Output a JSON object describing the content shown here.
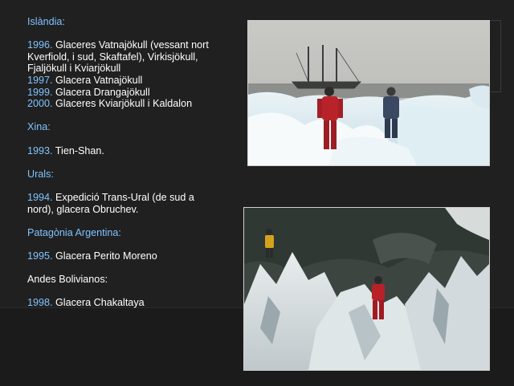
{
  "sections": {
    "islandia": {
      "heading": "Islàndia:",
      "entries": [
        {
          "year": "1996.",
          "text": "Glaceres Vatnajökull (vessant nort Kverfiold, i sud, Skaftafel), Virkisjökull, Fjaljökull i Kviarjökull"
        },
        {
          "year": "1997.",
          "text": "Glacera Vatnajökull"
        },
        {
          "year": "1999.",
          "text": "Glacera Drangajökull"
        },
        {
          "year": "2000.",
          "text": "Glaceres Kviarjökull i Kaldalon"
        }
      ]
    },
    "xina": {
      "heading": "Xina:",
      "entries": [
        {
          "year": "1993.",
          "text": "Tien-Shan."
        }
      ]
    },
    "urals": {
      "heading": "Urals:",
      "entries": [
        {
          "year": "1994.",
          "text": "Expedició Trans-Ural (de sud a nord), glacera Obruchev."
        }
      ]
    },
    "patagonia": {
      "heading": "Patagònia Argentina:",
      "entries": [
        {
          "year": "1995.",
          "text": "Glacera Perito Moreno"
        }
      ]
    },
    "andes": {
      "heading": "Andes Bolivianos:",
      "entries": [
        {
          "year": "1998.",
          "text": "Glacera Chakaltaya"
        }
      ]
    }
  },
  "photos": {
    "top": {
      "subject": "two expedition members on sea ice with a two-masted sailing ship behind"
    },
    "bottom": {
      "subject": "climbers in red and yellow suits on jagged glacier seracs"
    }
  },
  "colors": {
    "background": "#202020",
    "heading": "#7fc4ff",
    "year": "#7fc4ff",
    "body_text": "#ffffff",
    "andes_heading": "#ffffff"
  }
}
